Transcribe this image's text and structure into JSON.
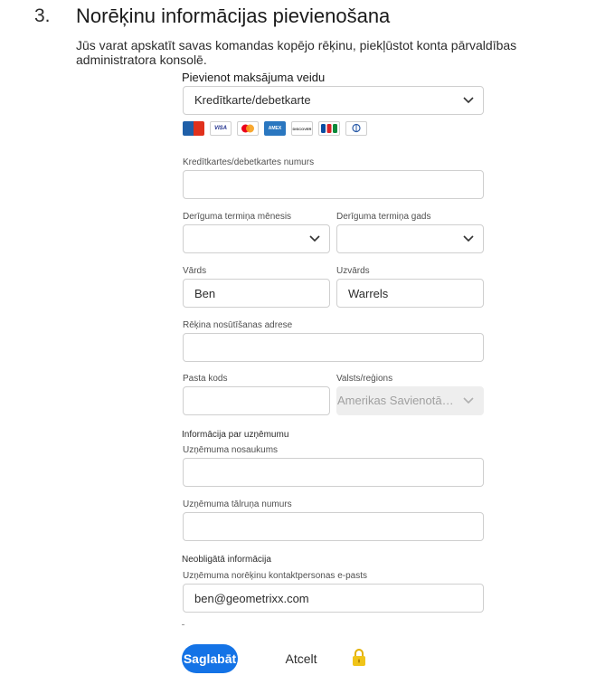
{
  "step": {
    "number": "3.",
    "title": "Norēķinu informācijas pievienošana",
    "intro": "Jūs varat apskatīt savas komandas kopējo rēķinu, piekļūstot konta pārvaldības administratora konsolē."
  },
  "payment_method": {
    "label": "Pievienot maksājuma veidu",
    "selected": "Kredītkarte/debetkarte",
    "card_brands": [
      "Diners Club",
      "VISA",
      "Mastercard",
      "AMEX",
      "DISCOVER",
      "JCB",
      "Diners Club"
    ]
  },
  "form": {
    "card_number": {
      "label": "Kredītkartes/debetkartes numurs",
      "value": ""
    },
    "exp_month": {
      "label": "Derīguma termiņa mēnesis",
      "value": ""
    },
    "exp_year": {
      "label": "Derīguma termiņa gads",
      "value": ""
    },
    "first_name": {
      "label": "Vārds",
      "value": "Ben"
    },
    "last_name": {
      "label": "Uzvārds",
      "value": "Warrels"
    },
    "billing_address": {
      "label": "Rēķina nosūtīšanas adrese",
      "value": ""
    },
    "postal_code": {
      "label": "Pasta kods",
      "value": ""
    },
    "country": {
      "label": "Valsts/reģions",
      "value": "Amerikas Savienotās Valstis"
    }
  },
  "company": {
    "heading": "Informācija par uzņēmumu",
    "name": {
      "label": "Uzņēmuma nosaukums",
      "value": ""
    },
    "phone": {
      "label": "Uzņēmuma tālruņa numurs",
      "value": ""
    }
  },
  "optional": {
    "heading": "Neobligātā informācija",
    "billing_email": {
      "label": "Uzņēmuma norēķinu kontaktpersonas e-pasts",
      "value": "ben@geometrixx.com"
    }
  },
  "actions": {
    "save": "Saglabāt",
    "cancel": "Atcelt",
    "lock_icon": "lock-icon"
  },
  "colors": {
    "primary": "#1473e6",
    "lock": "#f0c419"
  }
}
